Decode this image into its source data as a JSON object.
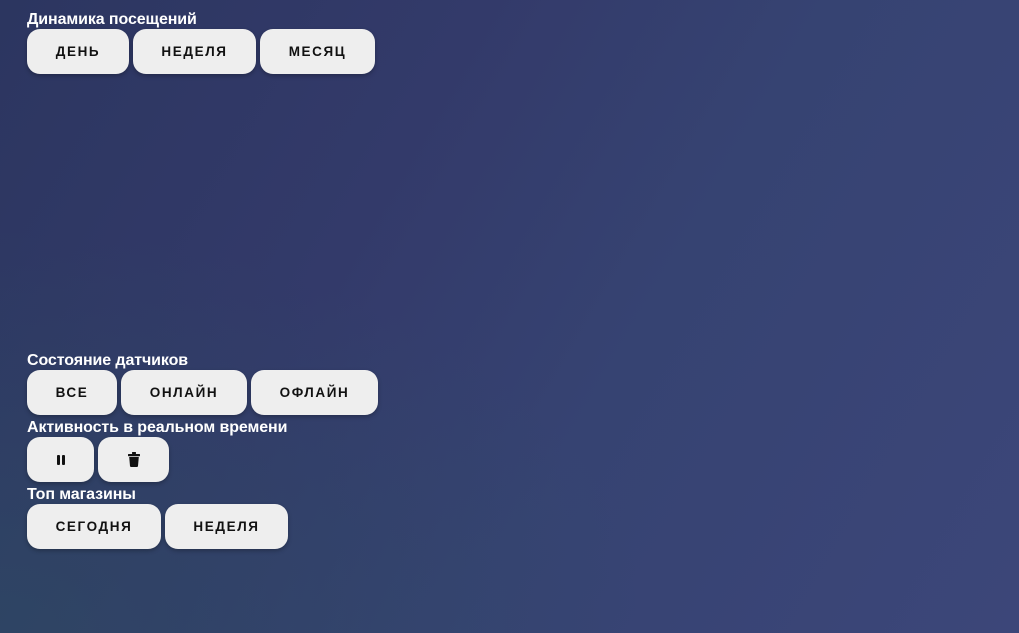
{
  "sections": {
    "visits": {
      "title": "Динамика посещений",
      "buttons": [
        "День",
        "Неделя",
        "Месяц"
      ]
    },
    "sensors": {
      "title": "Состояние датчиков",
      "buttons": [
        "Все",
        "Онлайн",
        "Офлайн"
      ]
    },
    "activity": {
      "title": "Активность в реальном времени",
      "buttons": [
        {
          "icon": "pause-icon"
        },
        {
          "icon": "trash-icon"
        }
      ]
    },
    "top_stores": {
      "title": "Топ магазины",
      "buttons": [
        "Сегодня",
        "Неделя"
      ]
    }
  },
  "colors": {
    "background_start": "#2c3660",
    "background_end": "#3c4679",
    "button_bg": "#eeeeee",
    "button_text": "#111111",
    "title_text": "#ffffff"
  }
}
